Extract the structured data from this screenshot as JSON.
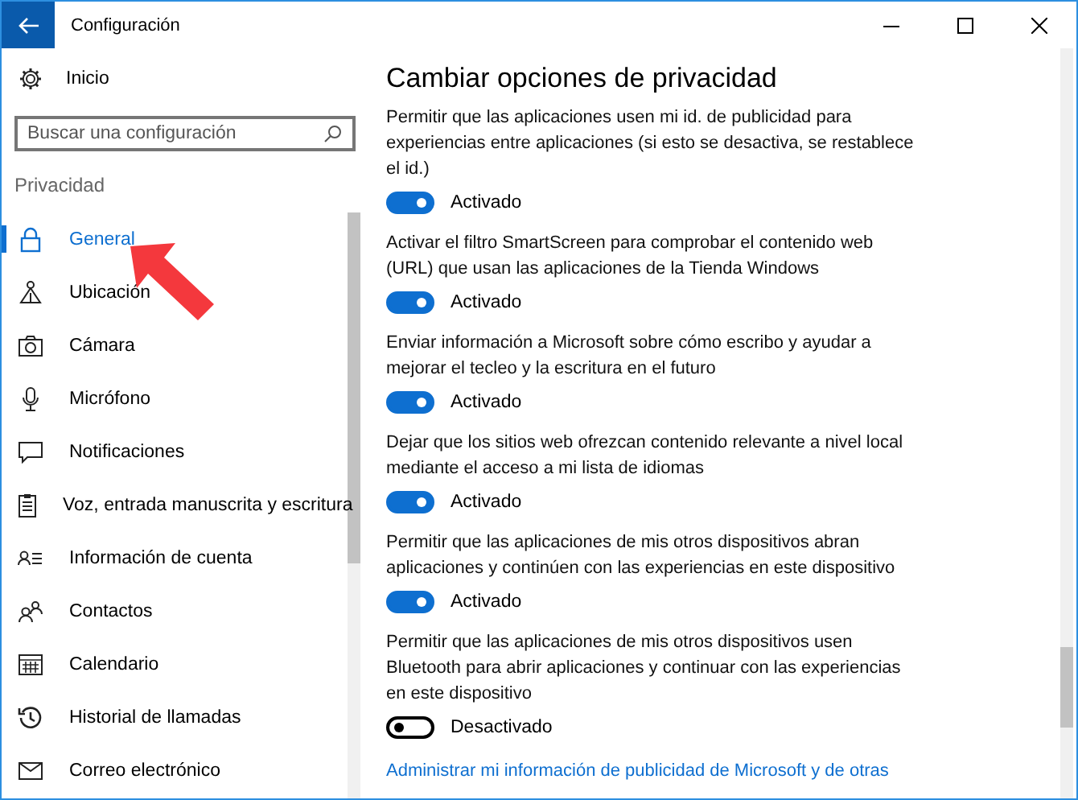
{
  "window": {
    "title": "Configuración"
  },
  "sidebar": {
    "home": "Inicio",
    "search": {
      "placeholder": "Buscar una configuración"
    },
    "section": "Privacidad",
    "items": [
      {
        "label": "General",
        "selected": true
      },
      {
        "label": "Ubicación",
        "selected": false
      },
      {
        "label": "Cámara",
        "selected": false
      },
      {
        "label": "Micrófono",
        "selected": false
      },
      {
        "label": "Notificaciones",
        "selected": false
      },
      {
        "label": "Voz, entrada manuscrita y escritura",
        "selected": false
      },
      {
        "label": "Información de cuenta",
        "selected": false
      },
      {
        "label": "Contactos",
        "selected": false
      },
      {
        "label": "Calendario",
        "selected": false
      },
      {
        "label": "Historial de llamadas",
        "selected": false
      },
      {
        "label": "Correo electrónico",
        "selected": false
      }
    ]
  },
  "content": {
    "heading": "Cambiar opciones de privacidad",
    "options": [
      {
        "description": "Permitir que las aplicaciones usen mi id. de publicidad para experiencias entre aplicaciones (si esto se desactiva, se restablece el id.)",
        "on": true,
        "state": "Activado"
      },
      {
        "description": "Activar el filtro SmartScreen para comprobar el contenido web (URL) que usan las aplicaciones de la Tienda Windows",
        "on": true,
        "state": "Activado"
      },
      {
        "description": "Enviar información a Microsoft sobre cómo escribo y ayudar a mejorar el tecleo y la escritura en el futuro",
        "on": true,
        "state": "Activado"
      },
      {
        "description": "Dejar que los sitios web ofrezcan contenido relevante a nivel local mediante el acceso a mi lista de idiomas",
        "on": true,
        "state": "Activado"
      },
      {
        "description": "Permitir que las aplicaciones de mis otros dispositivos abran aplicaciones y continúen con las experiencias en este dispositivo",
        "on": true,
        "state": "Activado"
      },
      {
        "description": "Permitir que las aplicaciones de mis otros dispositivos usen Bluetooth para abrir aplicaciones y continuar con las experiencias en este dispositivo",
        "on": false,
        "state": "Desactivado"
      }
    ],
    "link": "Administrar mi información de publicidad de Microsoft y de otras"
  }
}
